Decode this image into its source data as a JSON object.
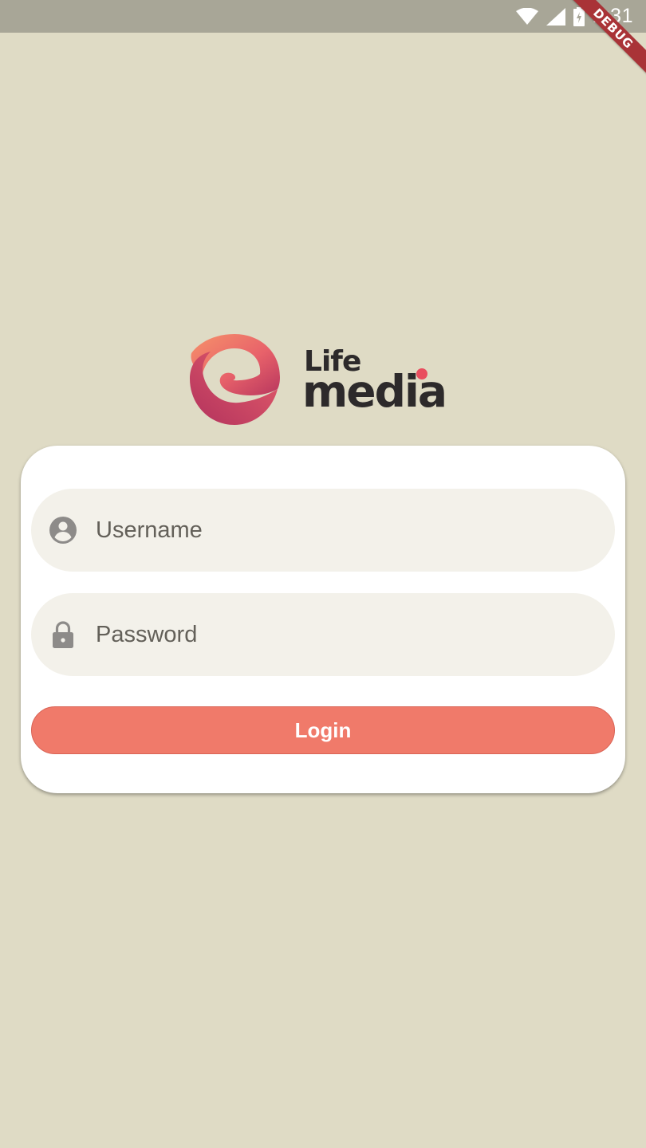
{
  "status_bar": {
    "time": "2:31",
    "icons": [
      "wifi-icon",
      "cellular-signal-icon",
      "battery-charging-icon"
    ]
  },
  "debug_banner": "DEBUG",
  "logo": {
    "line1": "Life",
    "line2": "media"
  },
  "login_form": {
    "username": {
      "placeholder": "Username",
      "value": "",
      "icon": "account-circle-icon"
    },
    "password": {
      "placeholder": "Password",
      "value": "",
      "icon": "lock-icon"
    },
    "login_button": "Login"
  },
  "colors": {
    "background": "#dfdbc5",
    "status_bar": "#a8a697",
    "card": "#ffffff",
    "field": "#f3f1ea",
    "button": "#f07a6a",
    "logo_text": "#2d2a2b",
    "logo_accent": "#e94e5f"
  }
}
